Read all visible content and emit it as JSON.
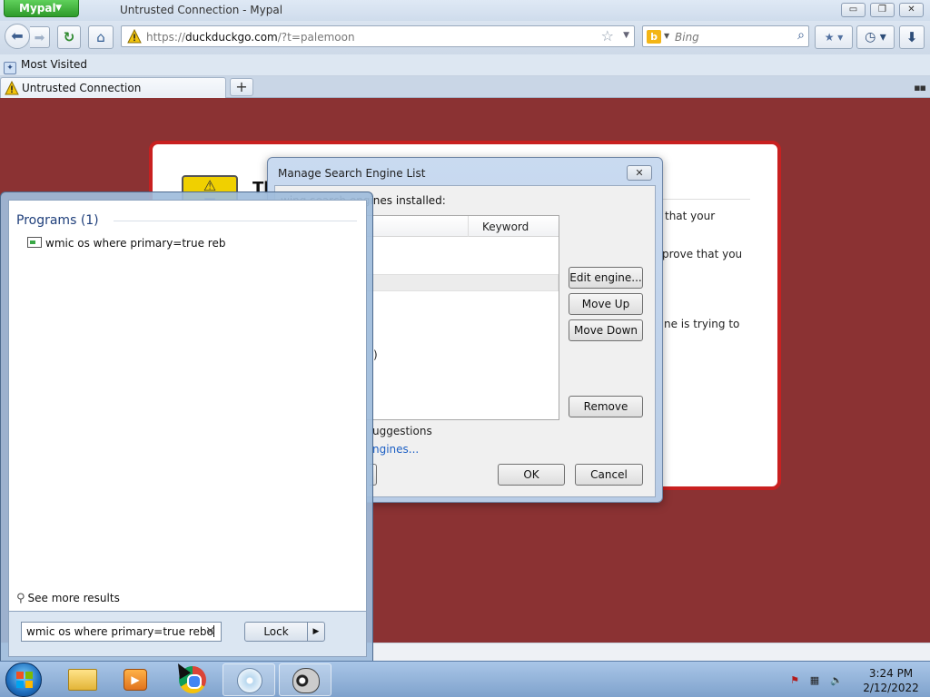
{
  "browser": {
    "app_button": "Mypal",
    "window_title": "Untrusted Connection - Mypal",
    "window_controls": {
      "minimize": "▭",
      "restore": "❐",
      "close": "✕"
    },
    "url": {
      "prefix": "https://",
      "host": "duckduckgo.com",
      "path": "/?t=palemoon"
    },
    "search": {
      "placeholder": "Bing",
      "engine_icon_letter": "b"
    },
    "bookmarks": {
      "most_visited": "Most Visited"
    },
    "tabs": [
      {
        "title": "Untrusted Connection"
      }
    ],
    "new_tab": "+"
  },
  "page": {
    "title_fragment": "Th",
    "text_fragments": [
      "that your",
      "prove that you",
      "ne is trying to"
    ]
  },
  "dialog": {
    "title": "Manage Search Engine List",
    "intro": "wing search engines installed:",
    "list": {
      "column_keyword": "Keyword",
      "fragment": ")"
    },
    "buttons": {
      "edit_engine": "Edit engine...",
      "move_up": "Move Up",
      "move_down": "Move Down",
      "remove": "Remove",
      "ok": "OK",
      "cancel": "Cancel"
    },
    "suggestions_fragment": "uggestions",
    "get_more_fragment": "ngines..."
  },
  "startmenu": {
    "programs_header": "Programs (1)",
    "program_result": "wmic os where primary=true reb",
    "see_more": "See more results",
    "search_value": "wmic os where primary=true rebo",
    "clear_icon": "×",
    "lock_label": "Lock"
  },
  "taskbar": {
    "items": [
      "explorer",
      "media-center",
      "chrome",
      "disc",
      "palemoon"
    ],
    "clock": {
      "time": "3:24 PM",
      "date": "2/12/2022"
    }
  },
  "colors": {
    "page_background": "#8b3233",
    "cert_border": "#c82020",
    "link": "#1c5fc4",
    "app_button": "#2e9b2a"
  }
}
